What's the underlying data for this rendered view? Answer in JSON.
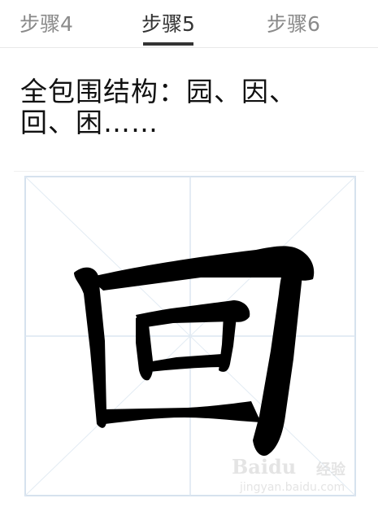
{
  "tabs": [
    {
      "label": "步骤4",
      "active": false
    },
    {
      "label": "步骤5",
      "active": true
    },
    {
      "label": "步骤6",
      "active": false
    }
  ],
  "content": {
    "step_text_line1": "全包围结构：园、因、",
    "step_text_line2": "回、困……"
  },
  "image": {
    "character": "回",
    "watermark_logo": "Baidu",
    "watermark_label": "经验",
    "watermark_url": "jingyan.baidu.com"
  },
  "colors": {
    "tab_inactive": "#8a8a8a",
    "tab_active": "#333333",
    "grid_line": "#dbe6f0",
    "ink": "#000000"
  }
}
